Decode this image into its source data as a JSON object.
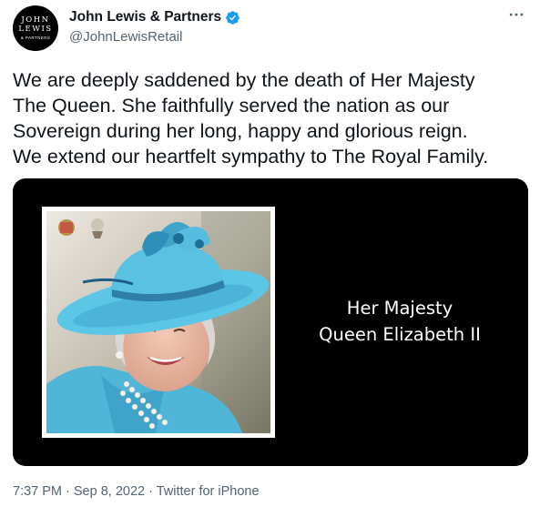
{
  "account": {
    "avatar_line1": "JOHN",
    "avatar_line2": "LEWIS",
    "avatar_line3": "& PARTNERS",
    "display_name": "John Lewis & Partners",
    "handle": "@JohnLewisRetail",
    "verified": true
  },
  "tweet": {
    "text": "We are deeply saddened by the death of Her Majesty\nThe Queen. She faithfully served the nation as our\nSovereign during her long, happy and glorious reign.\nWe extend our heartfelt sympathy to The Royal Family.",
    "media_caption_line1": "Her Majesty",
    "media_caption_line2": "Queen Elizabeth II"
  },
  "meta": {
    "time": "7:37 PM",
    "separator": " · ",
    "date": "Sep 8, 2022",
    "source": "Twitter for iPhone"
  },
  "icons": {
    "more": "more-options-icon",
    "verified": "verified-badge-icon"
  },
  "colors": {
    "verified_blue": "#1d9bf0",
    "text_primary": "#0f1419",
    "text_secondary": "#536471",
    "media_background": "#000000",
    "hat_blue": "#5cc6e6"
  }
}
